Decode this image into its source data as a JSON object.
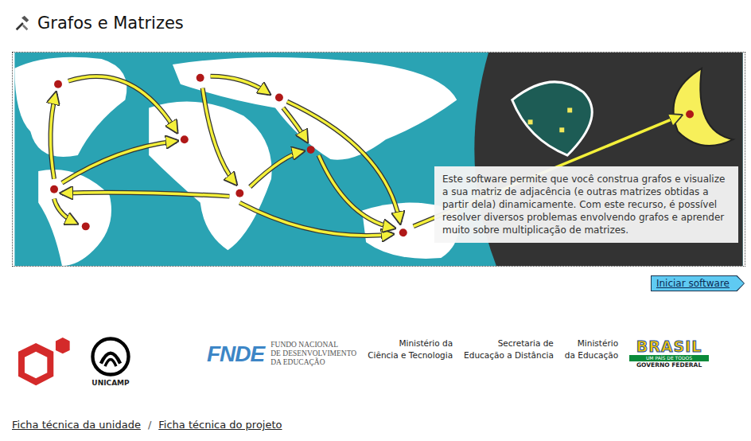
{
  "page": {
    "title": "Grafos e Matrizes"
  },
  "banner": {
    "description": "Este software permite que você construa grafos e visualize a sua matriz de adjacência (e outras matrizes obtidas a partir dela) dinamicamente. Com este recurso, é possível resolver diversos problemas envolvendo grafos e aprender muito sobre multiplicação de matrizes."
  },
  "start_button": {
    "label": "Iniciar software"
  },
  "logos": {
    "unicamp": "UNICAMP",
    "fnde": {
      "mark": "FNDE",
      "lines": [
        "FUNDO NACIONAL",
        "DE DESENVOLVIMENTO",
        "DA EDUCAÇÃO"
      ]
    },
    "ministries": [
      {
        "lines": [
          "Ministério da",
          "Ciência e Tecnologia"
        ]
      },
      {
        "lines": [
          "Secretaria de",
          "Educação a Distância"
        ]
      },
      {
        "lines": [
          "Ministério",
          "da Educação"
        ]
      }
    ],
    "brasil": {
      "word": "BRASIL",
      "tagline": "UM PAÍS DE TODOS",
      "caption": "GOVERNO FEDERAL"
    }
  },
  "footer": {
    "links": [
      "Ficha técnica da unidade",
      "Ficha técnica do projeto"
    ],
    "separator": "/"
  }
}
